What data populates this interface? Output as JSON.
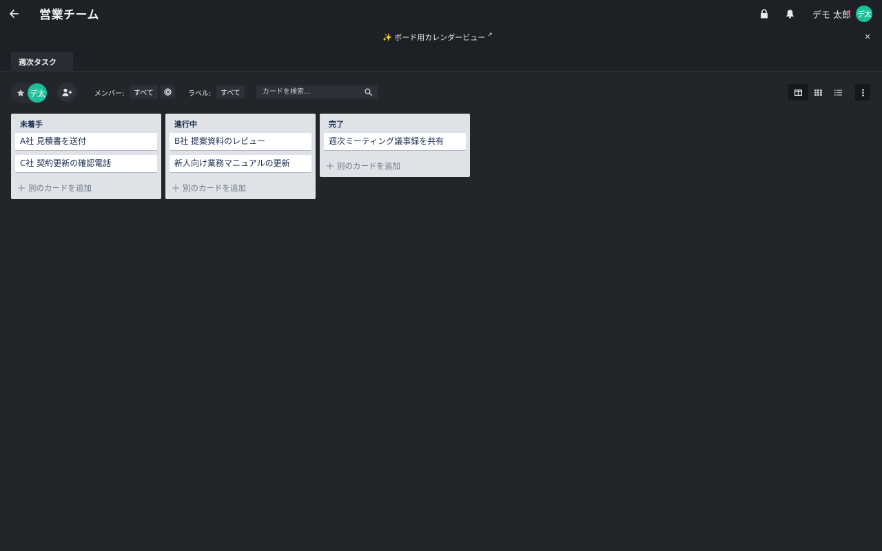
{
  "header": {
    "team_title": "営業チーム",
    "user_name": "デモ 太郎",
    "avatar_initials": "デ太",
    "icons": [
      "back-arrow-icon",
      "lock-icon",
      "bell-icon"
    ]
  },
  "announcement": {
    "text": "✨ ボード用カレンダービュー",
    "external_mark": "↗"
  },
  "tabs": [
    {
      "label": "週次タスク",
      "active": true
    }
  ],
  "toolbar": {
    "member_avatar": "デ太",
    "member_label": "メンバー:",
    "member_value": "すべて",
    "label_label": "ラベル:",
    "label_value": "すべて",
    "search_placeholder": "カードを検索...",
    "views": [
      "board-view",
      "grid-view",
      "list-view"
    ],
    "active_view": "board-view"
  },
  "lists": [
    {
      "title": "未着手",
      "cards": [
        "A社 見積書を送付",
        "C社 契約更新の確認電話"
      ],
      "add_label": "別のカードを追加"
    },
    {
      "title": "進行中",
      "cards": [
        "B社 提案資料のレビュー",
        "新人向け業務マニュアルの更新"
      ],
      "add_label": "別のカードを追加"
    },
    {
      "title": "完了",
      "cards": [
        "週次ミーティング議事録を共有"
      ],
      "add_label": "別のカードを追加"
    }
  ],
  "colors": {
    "background": "#22252a",
    "header": "#1d2024",
    "list": "#dfe2e6",
    "avatar": "#1fbf9c",
    "card_text": "#172b4d"
  }
}
